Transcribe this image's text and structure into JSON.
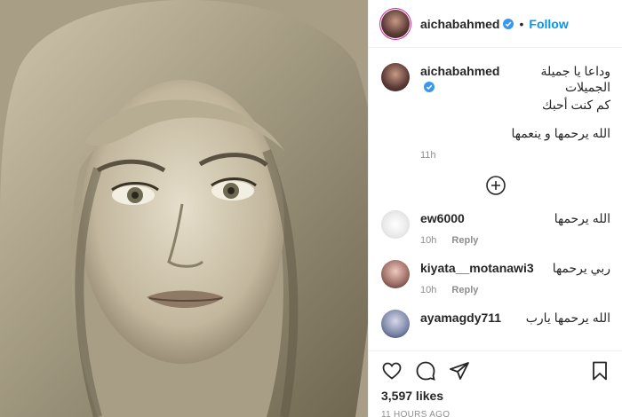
{
  "post": {
    "username": "aichabahmed",
    "follow_label": "Follow",
    "separator": "•"
  },
  "caption": {
    "username": "aichabahmed",
    "line1": "وداعا يا جميلة الجميلات",
    "line2": "كم كنت أحبك",
    "line3": "الله يرحمها و ينعمها",
    "time": "11h"
  },
  "comments": [
    {
      "username": "ew6000",
      "text": "الله يرحمها",
      "time": "10h",
      "reply": "Reply"
    },
    {
      "username": "kiyata__motanawi3",
      "text": "ربي يرحمها",
      "time": "10h",
      "reply": "Reply"
    },
    {
      "username": "ayamagdy711",
      "text": "الله يرحمها يارب"
    }
  ],
  "stats": {
    "likes": "3,597 likes",
    "posted": "11 HOURS AGO"
  },
  "icons": {
    "verified": "verified-badge-icon",
    "load_more": "plus-circle-icon",
    "like": "heart-icon",
    "comment": "speech-bubble-icon",
    "share": "paper-plane-icon",
    "save": "bookmark-icon"
  },
  "colors": {
    "link": "#0095f6",
    "verified": "#3897f0",
    "muted": "#8e8e8e",
    "text": "#262626"
  }
}
